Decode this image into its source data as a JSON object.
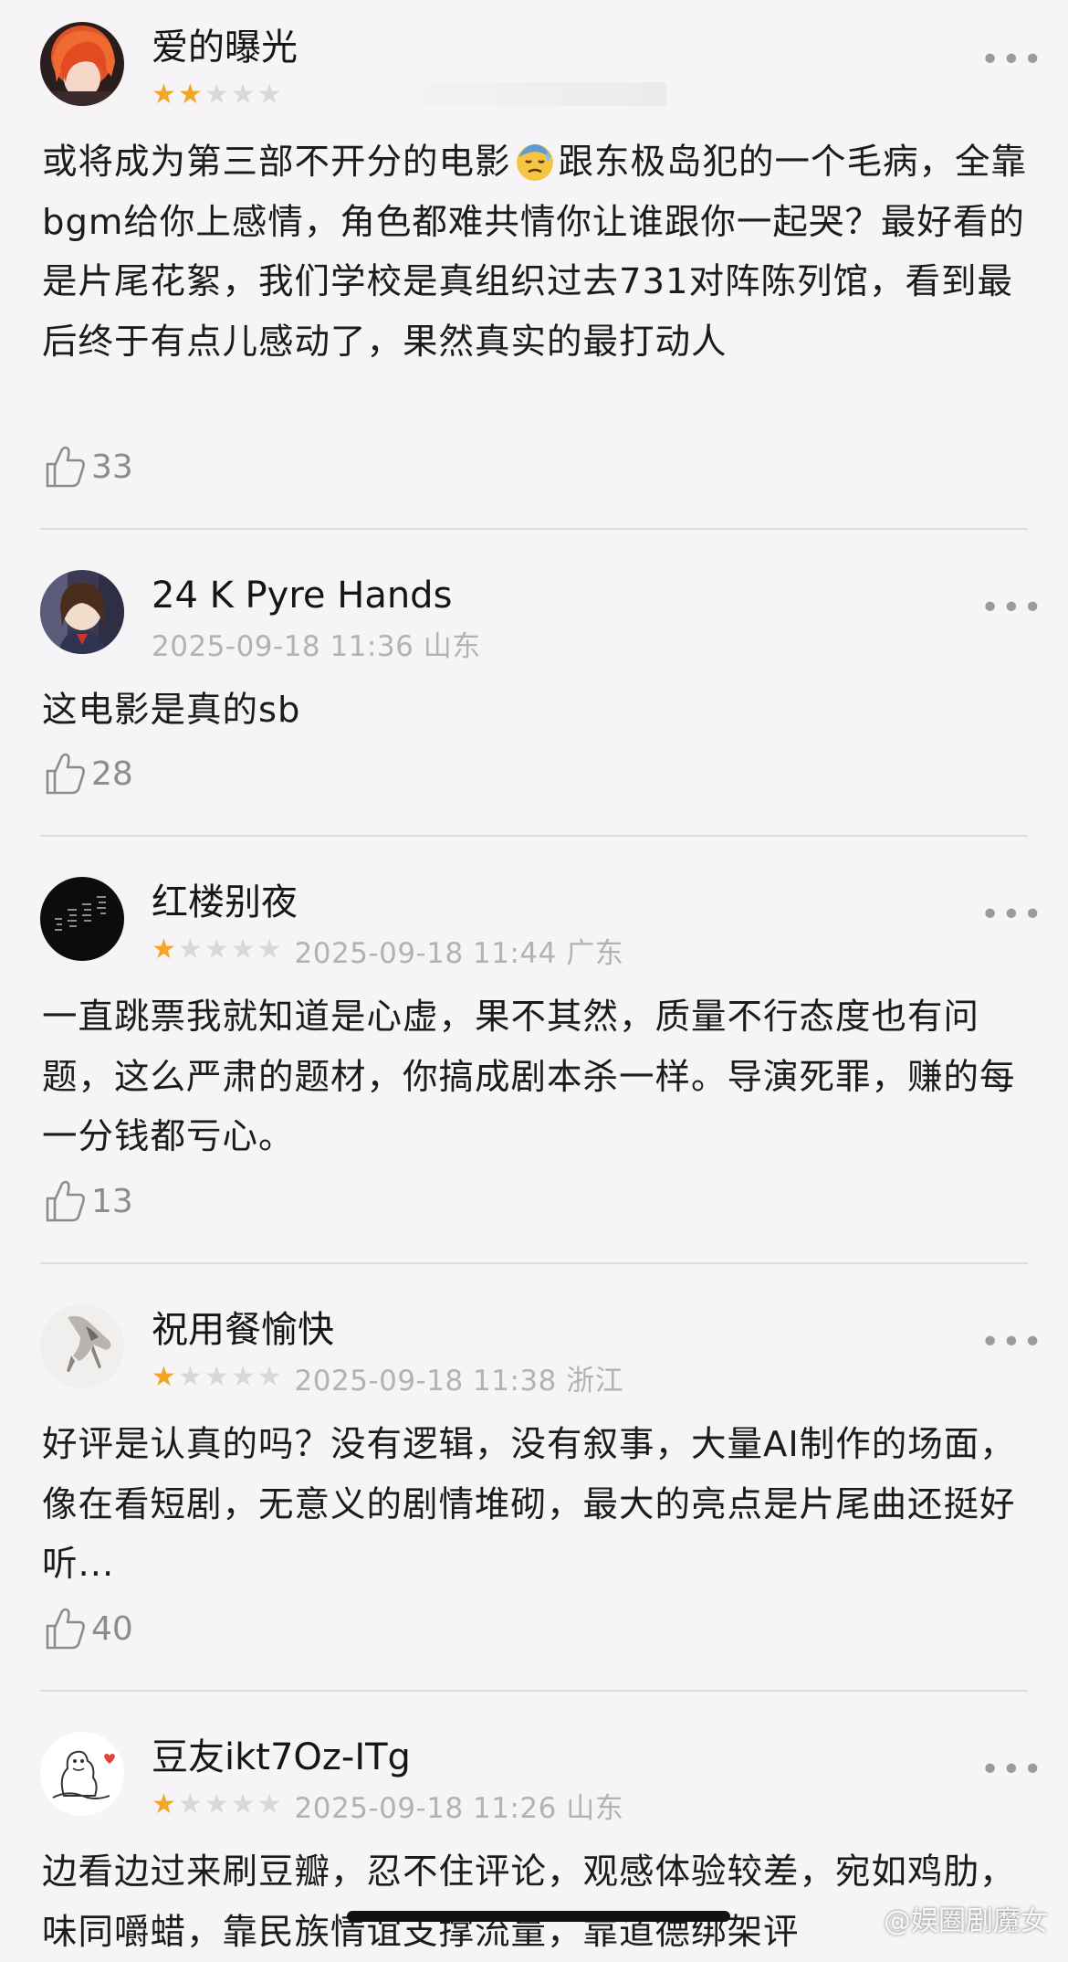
{
  "comments": [
    {
      "username": "爱的曝光",
      "rating": 2,
      "meta": "",
      "text_parts": [
        "或将成为第三部不开分的电影",
        "跟东极岛犯的一个毛病，全靠bgm给你上感情，角色都难共情你让谁跟你一起哭？最好看的是片尾花絮，我们学校是真组织过去731对阵陈列馆，看到最后终于有点儿感动了，果然真实的最打动人"
      ],
      "emoji": "downcast-face-with-sweat",
      "likes": "33"
    },
    {
      "username": "24 K Pyre Hands",
      "rating": 0,
      "meta": "2025-09-18 11:36 山东",
      "text": "这电影是真的sb",
      "likes": "28"
    },
    {
      "username": "红楼别夜",
      "rating": 1,
      "meta": "2025-09-18 11:44 广东",
      "text": "一直跳票我就知道是心虚，果不其然，质量不行态度也有问题，这么严肃的题材，你搞成剧本杀一样。导演死罪，赚的每一分钱都亏心。",
      "likes": "13"
    },
    {
      "username": "祝用餐愉快",
      "rating": 1,
      "meta": "2025-09-18 11:38 浙江",
      "text": "好评是认真的吗？没有逻辑，没有叙事，大量AI制作的场面，像在看短剧，无意义的剧情堆砌，最大的亮点是片尾曲还挺好听...",
      "likes": "40"
    },
    {
      "username": "豆友ikt7Oz-ITg",
      "rating": 1,
      "meta": "2025-09-18 11:26 山东",
      "text": "边看边过来刷豆瓣，忍不住评论，观感体验较差，宛如鸡肋，味同嚼蜡，靠民族情谊支撑流量，靠道德绑架评"
    }
  ],
  "watermark": "@娱圈剧魔女",
  "colors": {
    "background": "#f6f4f6",
    "star_on": "#f3a526",
    "star_off": "#d9d7d9",
    "meta_gray": "#b3b1b3"
  },
  "icons": {
    "more": "more-dots-icon",
    "like": "thumb-up-icon",
    "star": "star-icon"
  }
}
